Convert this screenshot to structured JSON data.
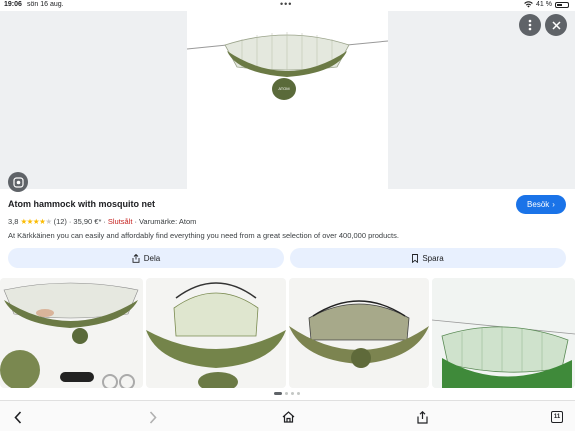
{
  "status_bar": {
    "time": "19:06",
    "date": "sön 16 aug.",
    "battery": "41 %"
  },
  "hero": {
    "main_image_icon": "hammock-image",
    "more_icon": "more-vert-icon",
    "close_icon": "close-icon",
    "lens_icon": "lens-icon"
  },
  "product": {
    "title": "Atom hammock with mosquito net",
    "visit_label": "Besök",
    "rating": "3,8",
    "review_count": "(12)",
    "price": "35,90 €*",
    "stock": "Slutsålt",
    "brand": "Varumärke: Atom",
    "description": "At Kärkkäinen you can easily and affordably find everything you need from a great selection of over 400,000 products."
  },
  "actions": {
    "share_label": "Dela",
    "save_label": "Spara"
  },
  "thumbnails": [
    "hammock-with-accessories",
    "hammock-pop-up-net",
    "hammock-dome-net",
    "hammock-tied-trees"
  ],
  "toolbar": {
    "tabs_count": "11"
  },
  "colors": {
    "accent": "#1a73e8",
    "sold_out": "#c5221f",
    "star": "#fbbc04",
    "hammock_green": "#6b7a45"
  }
}
